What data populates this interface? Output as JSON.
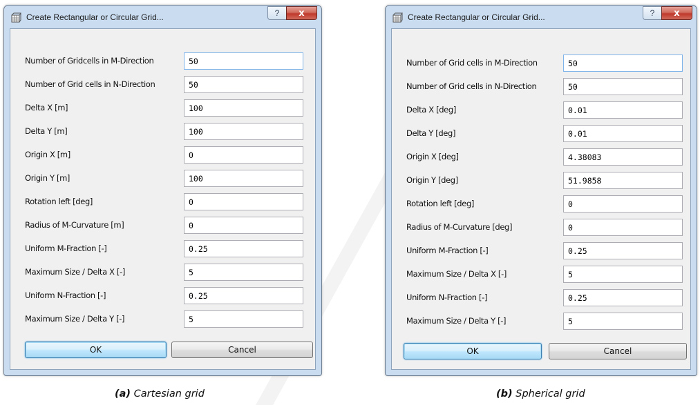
{
  "dialogs": [
    {
      "title": "Create Rectangular or Circular Grid...",
      "help_glyph": "?",
      "close_glyph": "x",
      "icon": "grid-app-icon",
      "fields": [
        {
          "label": "Number of Gridcells in M-Direction",
          "value": "50",
          "focused": true
        },
        {
          "label": "Number of Grid cells in N-Direction",
          "value": "50"
        },
        {
          "label": "Delta X [m]",
          "value": "100"
        },
        {
          "label": "Delta Y [m]",
          "value": "100"
        },
        {
          "label": "Origin X [m]",
          "value": "0"
        },
        {
          "label": "Origin Y [m]",
          "value": "100"
        },
        {
          "label": "Rotation left [deg]",
          "value": "0"
        },
        {
          "label": "Radius of M-Curvature [m]",
          "value": "0"
        },
        {
          "label": "Uniform M-Fraction [-]",
          "value": "0.25"
        },
        {
          "label": "Maximum Size / Delta X [-]",
          "value": "5"
        },
        {
          "label": "Uniform N-Fraction [-]",
          "value": "0.25"
        },
        {
          "label": "Maximum Size / Delta Y [-]",
          "value": "5"
        }
      ],
      "ok_label": "OK",
      "cancel_label": "Cancel",
      "caption_tag": "(a)",
      "caption_text": " Cartesian grid"
    },
    {
      "title": "Create Rectangular or Circular Grid...",
      "help_glyph": "?",
      "close_glyph": "x",
      "icon": "grid-app-icon",
      "fields": [
        {
          "label": "Number of Grid cells in M-Direction",
          "value": "50",
          "focused": true
        },
        {
          "label": "Number of Grid cells in N-Direction",
          "value": "50"
        },
        {
          "label": "Delta X [deg]",
          "value": "0.01"
        },
        {
          "label": "Delta Y [deg]",
          "value": "0.01"
        },
        {
          "label": "Origin X [deg]",
          "value": "4.38083"
        },
        {
          "label": "Origin Y [deg]",
          "value": "51.9858"
        },
        {
          "label": "Rotation left [deg]",
          "value": "0"
        },
        {
          "label": "Radius of M-Curvature [deg]",
          "value": "0"
        },
        {
          "label": "Uniform M-Fraction [-]",
          "value": "0.25"
        },
        {
          "label": "Maximum Size / Delta X [-]",
          "value": "5"
        },
        {
          "label": "Uniform N-Fraction [-]",
          "value": "0.25"
        },
        {
          "label": "Maximum Size / Delta Y [-]",
          "value": "5"
        }
      ],
      "ok_label": "OK",
      "cancel_label": "Cancel",
      "caption_tag": "(b)",
      "caption_text": " Spherical grid"
    }
  ],
  "colors": {
    "window_frame": "#c9dcf0",
    "client_bg": "#f0f0f0",
    "close_button": "#c0392b",
    "default_button_border": "#3c7fb1"
  }
}
